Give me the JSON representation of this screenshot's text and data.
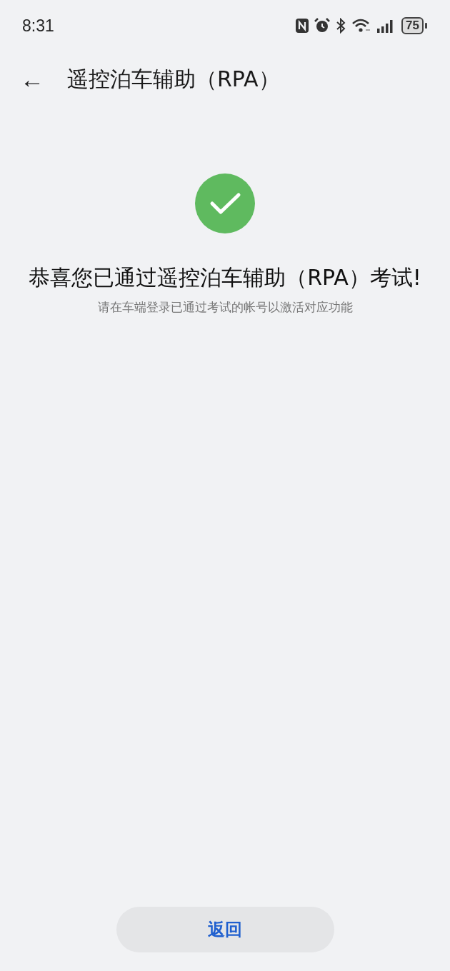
{
  "status_bar": {
    "time": "8:31",
    "battery": "75"
  },
  "header": {
    "back_glyph": "←",
    "title": "遥控泊车辅助（RPA）"
  },
  "result": {
    "passed": true,
    "title": "恭喜您已通过遥控泊车辅助（RPA）考试!",
    "subtitle": "请在车端登录已通过考试的帐号以激活对应功能"
  },
  "footer": {
    "button": "返回"
  }
}
